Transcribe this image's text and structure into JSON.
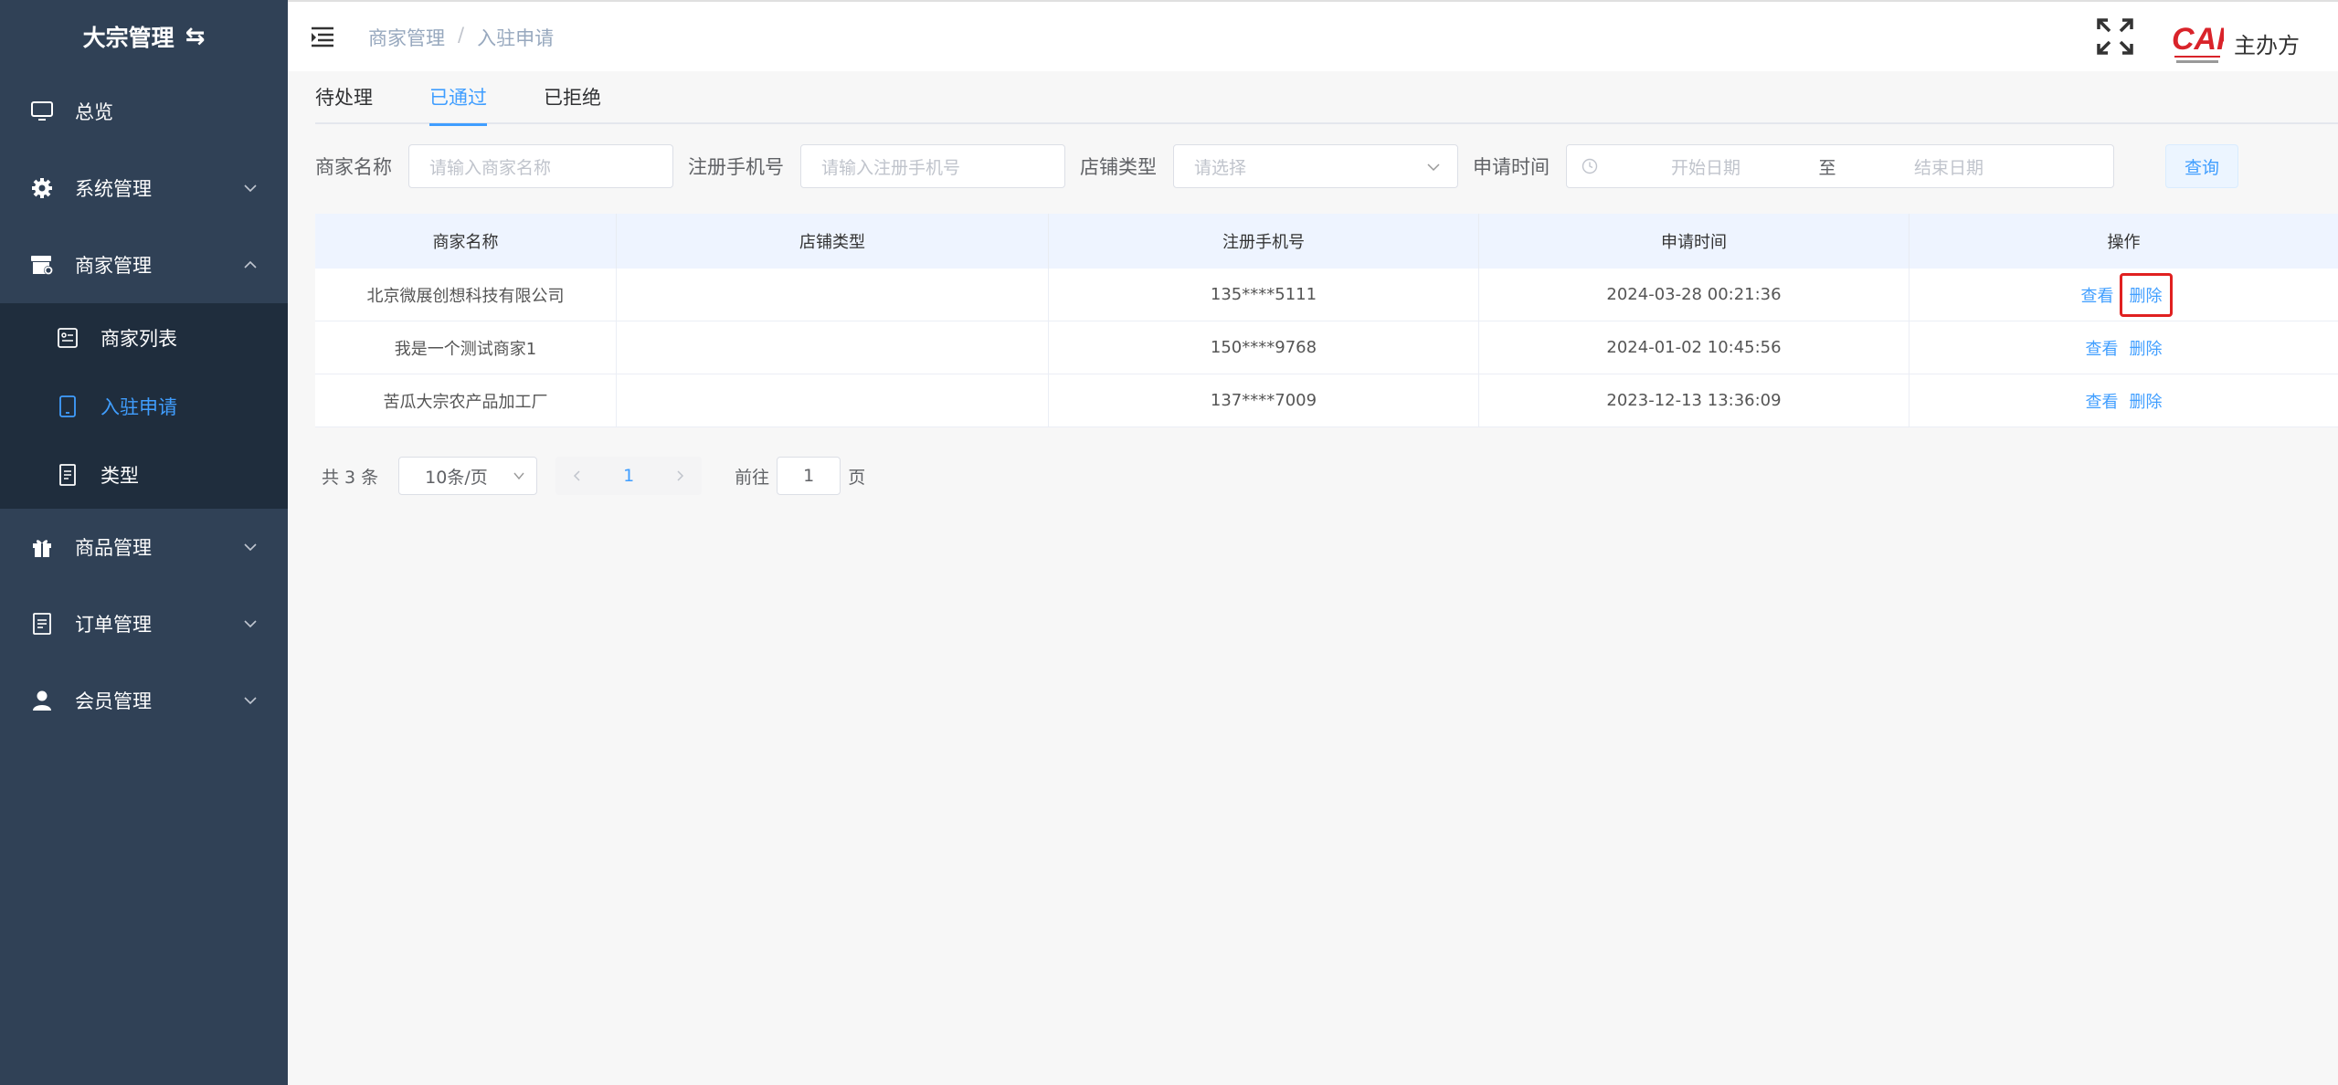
{
  "sidebar": {
    "brand": "大宗管理",
    "brand_icon": "swap-icon",
    "items": [
      {
        "label": "总览",
        "icon": "monitor-icon"
      },
      {
        "label": "系统管理",
        "icon": "gear-icon"
      },
      {
        "label": "商家管理",
        "icon": "store-icon"
      },
      {
        "label": "商品管理",
        "icon": "gift-icon"
      },
      {
        "label": "订单管理",
        "icon": "document-icon"
      },
      {
        "label": "会员管理",
        "icon": "user-icon"
      }
    ],
    "sub_items": [
      {
        "label": "商家列表",
        "icon": "list-icon"
      },
      {
        "label": "入驻申请",
        "icon": "tablet-icon"
      },
      {
        "label": "类型",
        "icon": "document-icon"
      }
    ]
  },
  "header": {
    "breadcrumb": [
      "商家管理",
      "入驻申请"
    ],
    "breadcrumb_sep": "/",
    "logo_text": "CAF",
    "org_label": "主办方"
  },
  "tabs": [
    "待处理",
    "已通过",
    "已拒绝"
  ],
  "filters": {
    "merchant_name_label": "商家名称",
    "merchant_name_placeholder": "请输入商家名称",
    "phone_label": "注册手机号",
    "phone_placeholder": "请输入注册手机号",
    "store_type_label": "店铺类型",
    "store_type_placeholder": "请选择",
    "apply_time_label": "申请时间",
    "start_placeholder": "开始日期",
    "range_sep": "至",
    "end_placeholder": "结束日期",
    "query_button": "查询"
  },
  "table": {
    "headers": [
      "商家名称",
      "店铺类型",
      "注册手机号",
      "申请时间",
      "操作"
    ],
    "rows": [
      {
        "name": "北京微展创想科技有限公司",
        "type": "",
        "phone": "135****5111",
        "time": "2024-03-28 00:21:36"
      },
      {
        "name": "我是一个测试商家1",
        "type": "",
        "phone": "150****9768",
        "time": "2024-01-02 10:45:56"
      },
      {
        "name": "苦瓜大宗农产品加工厂",
        "type": "",
        "phone": "137****7009",
        "time": "2023-12-13 13:36:09"
      }
    ],
    "view_label": "查看",
    "delete_label": "删除"
  },
  "pagination": {
    "total": "共 3 条",
    "page_size": "10条/页",
    "current_page": "1",
    "goto_label": "前往",
    "goto_value": "1",
    "page_suffix": "页"
  },
  "colors": {
    "sidebar_bg": "#304156",
    "submenu_bg": "#1f2d3d",
    "accent": "#409eff",
    "highlight": "#e02020"
  }
}
